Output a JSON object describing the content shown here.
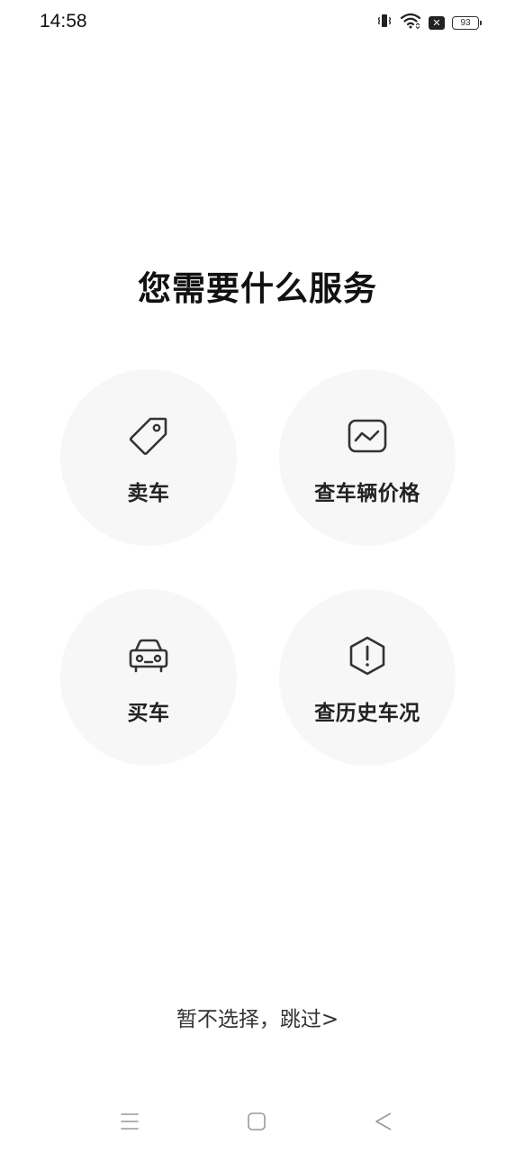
{
  "status_bar": {
    "time": "14:58",
    "battery_level": "93",
    "x_badge": "✕",
    "icons": [
      "vibrate-icon",
      "wifi-icon",
      "x-badge-icon",
      "battery-icon"
    ]
  },
  "page": {
    "title": "您需要什么服务"
  },
  "services": {
    "sell": {
      "label": "卖车",
      "icon": "price-tag-icon"
    },
    "price": {
      "label": "查车辆价格",
      "icon": "price-chart-icon"
    },
    "buy": {
      "label": "买车",
      "icon": "car-icon"
    },
    "history": {
      "label": "查历史车况",
      "icon": "alert-hexagon-icon"
    }
  },
  "skip": {
    "label": "暂不选择，跳过>"
  },
  "nav_bar": {
    "icons": [
      "menu-icon",
      "home-icon",
      "back-icon"
    ]
  },
  "colors": {
    "background": "#ffffff",
    "card": "#f7f7f7",
    "text": "#111111",
    "icon": "#333333"
  }
}
